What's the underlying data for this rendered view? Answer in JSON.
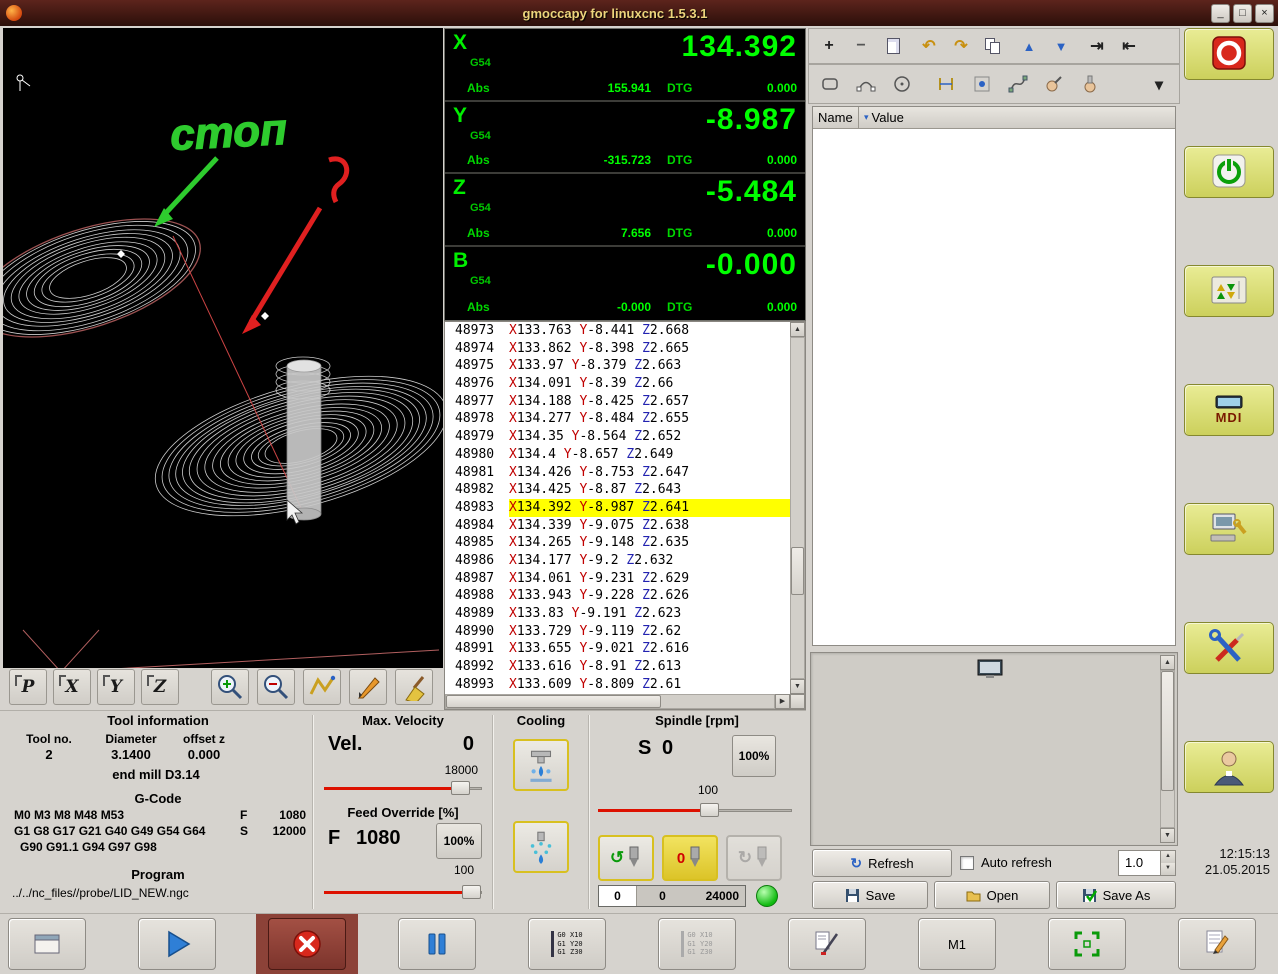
{
  "window": {
    "title": "gmoccapy for linuxcnc  1.5.3.1"
  },
  "icons": {
    "minimize": "_",
    "maximize": "□",
    "close": "×",
    "add": "+",
    "remove": "−",
    "undo": "↶",
    "redo": "↷",
    "move_up": "▲",
    "move_down": "▼",
    "indent": "⇥",
    "unindent": "⇤",
    "dropdown": "▾",
    "refresh": "↻",
    "scroll_up": "▲",
    "scroll_down": "▼",
    "scroll_right": "▶"
  },
  "preview": {
    "annotation": "стоп"
  },
  "preview_toolbar": {
    "p": "P",
    "x": "X",
    "y": "Y",
    "z": "Z"
  },
  "dro": {
    "axes": [
      {
        "letter": "X",
        "system": "G54",
        "abs_label": "Abs",
        "abs_value": "155.941",
        "dtg_label": "DTG",
        "dtg_value": "0.000",
        "value": "134.392"
      },
      {
        "letter": "Y",
        "system": "G54",
        "abs_label": "Abs",
        "abs_value": "-315.723",
        "dtg_label": "DTG",
        "dtg_value": "0.000",
        "value": "-8.987"
      },
      {
        "letter": "Z",
        "system": "G54",
        "abs_label": "Abs",
        "abs_value": "7.656",
        "dtg_label": "DTG",
        "dtg_value": "0.000",
        "value": "-5.484"
      },
      {
        "letter": "B",
        "system": "G54",
        "abs_label": "Abs",
        "abs_value": "-0.000",
        "dtg_label": "DTG",
        "dtg_value": "0.000",
        "value": "-0.000"
      }
    ]
  },
  "gcode": {
    "highlight": "48983",
    "lines": [
      {
        "n": "48973",
        "code": "X133.763 Y-8.441 Z2.668"
      },
      {
        "n": "48974",
        "code": "X133.862 Y-8.398 Z2.665"
      },
      {
        "n": "48975",
        "code": "X133.97 Y-8.379 Z2.663"
      },
      {
        "n": "48976",
        "code": "X134.091 Y-8.39 Z2.66"
      },
      {
        "n": "48977",
        "code": "X134.188 Y-8.425 Z2.657"
      },
      {
        "n": "48978",
        "code": "X134.277 Y-8.484 Z2.655"
      },
      {
        "n": "48979",
        "code": "X134.35 Y-8.564 Z2.652"
      },
      {
        "n": "48980",
        "code": "X134.4 Y-8.657 Z2.649"
      },
      {
        "n": "48981",
        "code": "X134.426 Y-8.753 Z2.647"
      },
      {
        "n": "48982",
        "code": "X134.425 Y-8.87 Z2.643"
      },
      {
        "n": "48983",
        "code": "X134.392 Y-8.987 Z2.641"
      },
      {
        "n": "48984",
        "code": "X134.339 Y-9.075 Z2.638"
      },
      {
        "n": "48985",
        "code": "X134.265 Y-9.148 Z2.635"
      },
      {
        "n": "48986",
        "code": "X134.177 Y-9.2 Z2.632"
      },
      {
        "n": "48987",
        "code": "X134.061 Y-9.231 Z2.629"
      },
      {
        "n": "48988",
        "code": "X133.943 Y-9.228 Z2.626"
      },
      {
        "n": "48989",
        "code": "X133.83 Y-9.191 Z2.623"
      },
      {
        "n": "48990",
        "code": "X133.729 Y-9.119 Z2.62"
      },
      {
        "n": "48991",
        "code": "X133.655 Y-9.021 Z2.616"
      },
      {
        "n": "48992",
        "code": "X133.616 Y-8.91 Z2.613"
      },
      {
        "n": "48993",
        "code": "X133.609 Y-8.809 Z2.61"
      }
    ]
  },
  "tool_info": {
    "title": "Tool information",
    "col_tool_no": "Tool no.",
    "col_diameter": "Diameter",
    "col_offset_z": "offset z",
    "tool_no": "2",
    "diameter": "3.1400",
    "offset_z": "0.000",
    "description": "end mill D3.14"
  },
  "gcode_state": {
    "title": "G-Code",
    "line1": "M0 M3 M8 M48 M53",
    "line2": "G1 G8 G17 G21 G40 G49 G54 G64",
    "line3": "G90 G91.1 G94 G97 G98",
    "f_label": "F",
    "f_value": "1080",
    "s_label": "S",
    "s_value": "12000"
  },
  "program": {
    "title": "Program",
    "path": "../../nc_files//probe/LID_NEW.ngc"
  },
  "velocity": {
    "title": "Max. Velocity",
    "label": "Vel.",
    "value": "0",
    "scale_max": "18000"
  },
  "feed": {
    "title": "Feed Override [%]",
    "label": "F",
    "value": "1080",
    "percent": "100%",
    "scale_max": "100"
  },
  "cooling": {
    "title": "Cooling"
  },
  "spindle": {
    "title": "Spindle [rpm]",
    "label": "S",
    "value": "0",
    "percent": "100%",
    "scale_max": "100",
    "readout_min": "0",
    "readout_value": "0",
    "readout_max": "24000"
  },
  "right_panel": {
    "name_header": "Name",
    "value_header": "Value",
    "refresh_label": "Refresh",
    "auto_refresh_label": "Auto refresh",
    "interval": "1.0",
    "save_label": "Save",
    "open_label": "Open",
    "save_as_label": "Save As"
  },
  "side": {
    "mdi_label": "MDI"
  },
  "clock": {
    "time": "12:15:13",
    "date": "21.05.2015"
  },
  "bottom_bar": {
    "m1_label": "M1",
    "gcode_lines": [
      "G0 X10",
      "G1 Y20",
      "G1 Z30"
    ]
  }
}
